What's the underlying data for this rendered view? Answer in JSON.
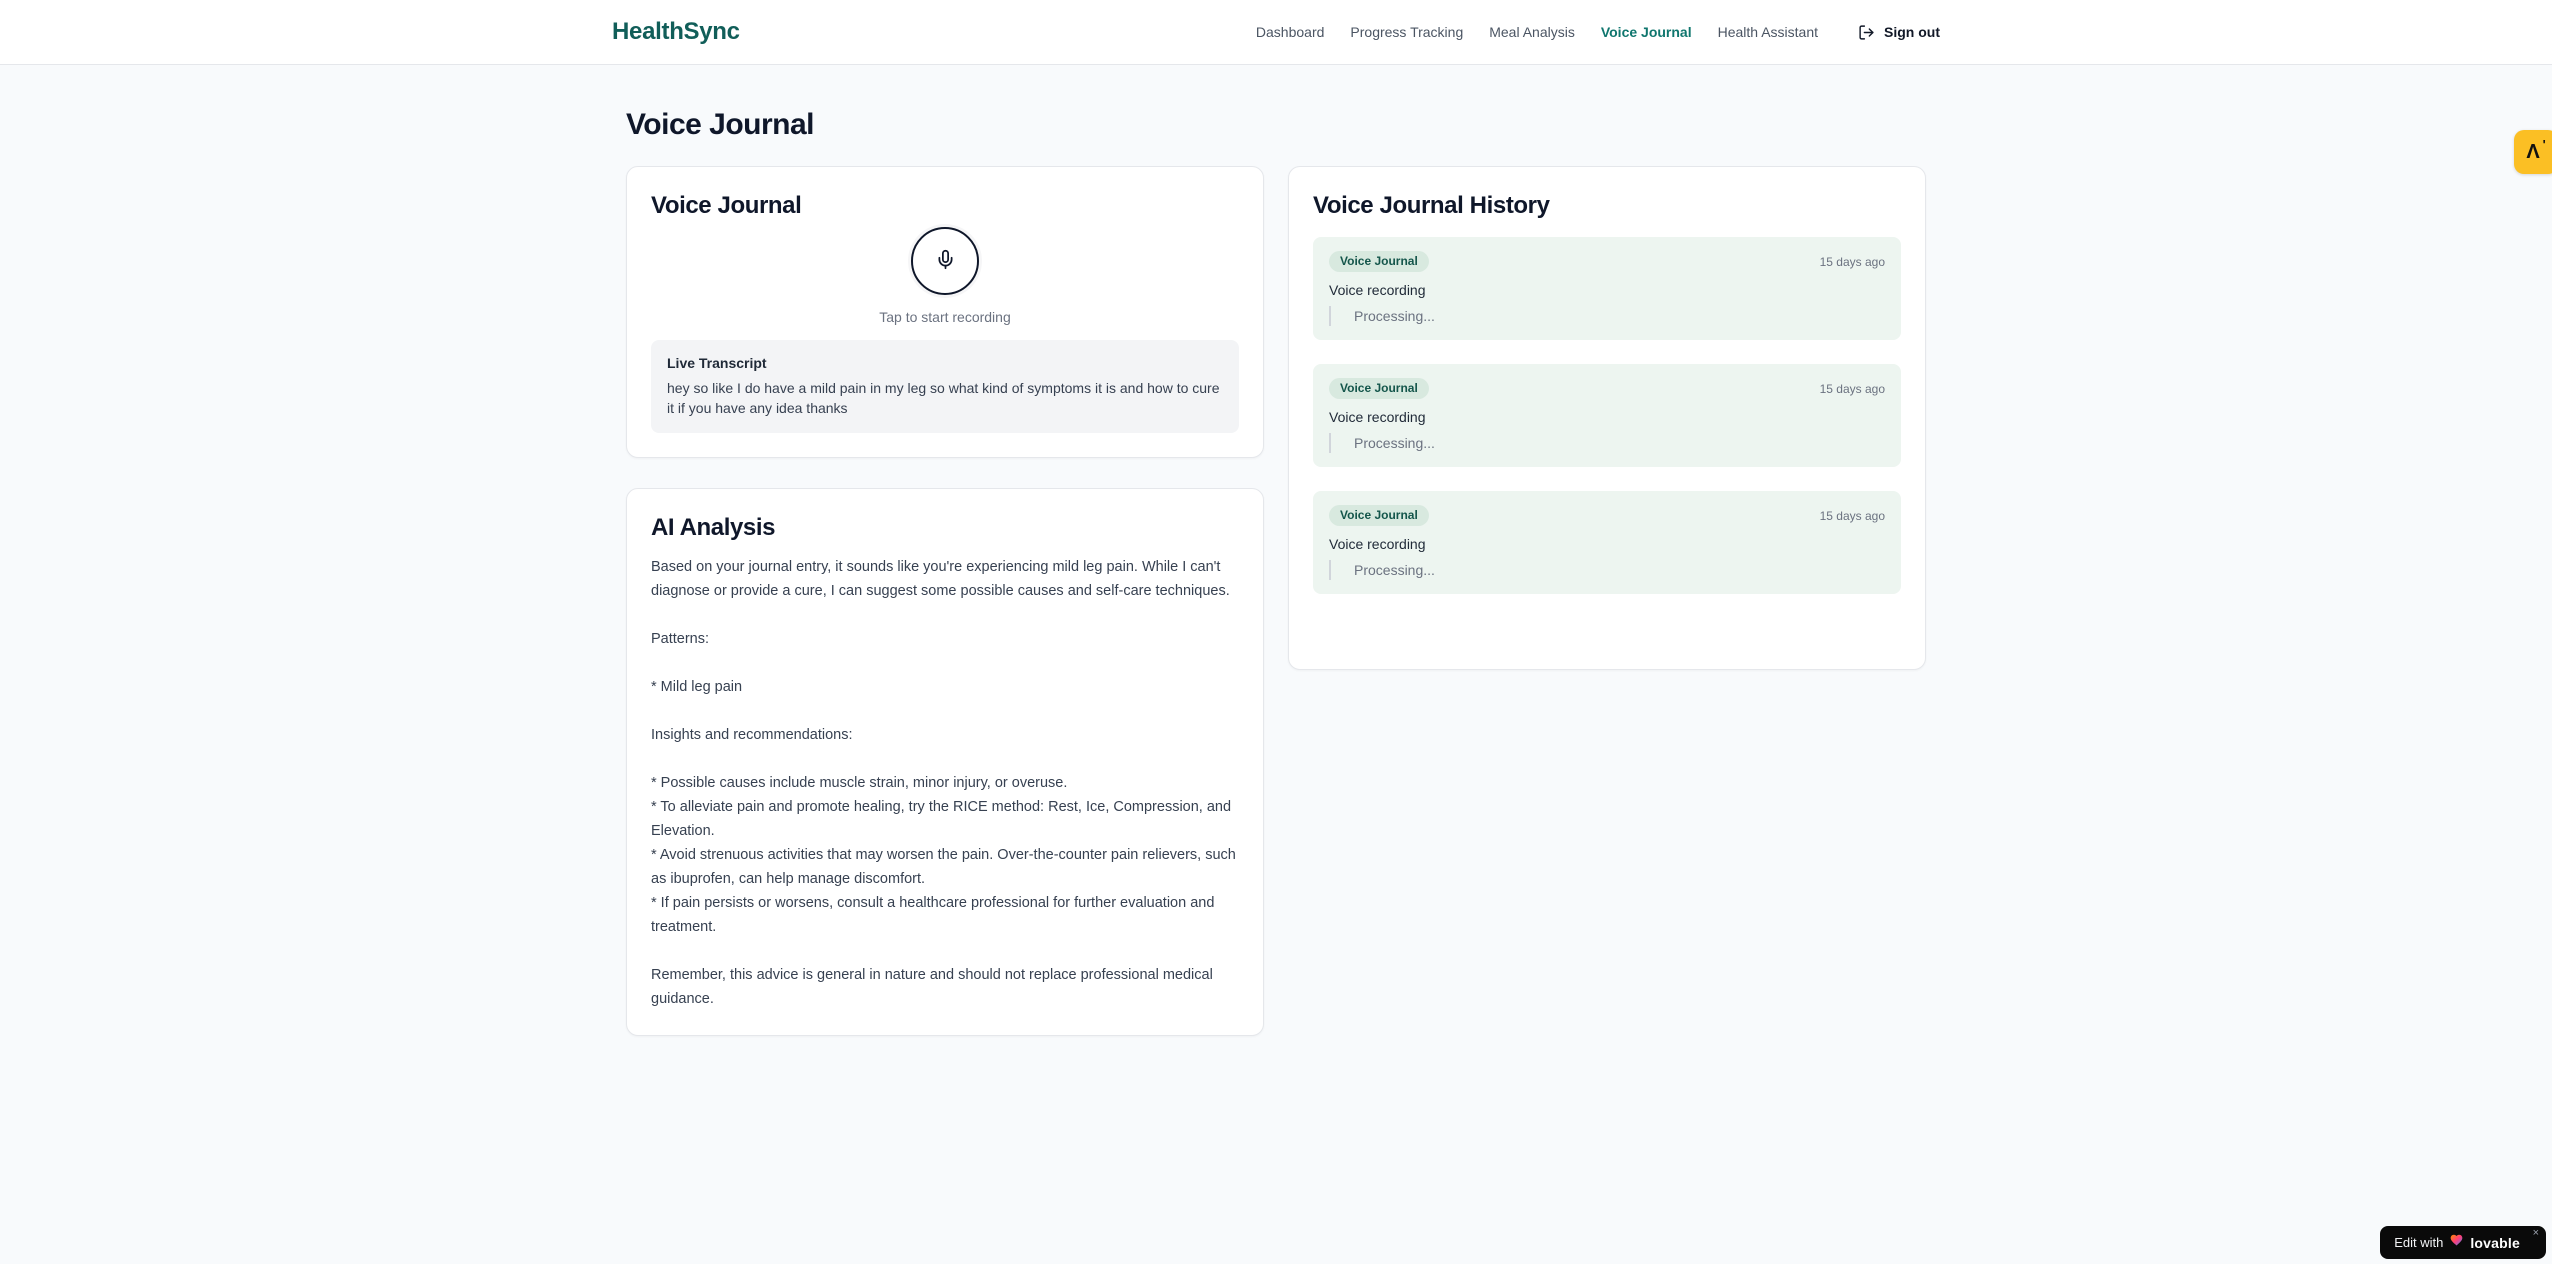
{
  "header": {
    "logo": "HealthSync",
    "nav": [
      {
        "label": "Dashboard",
        "active": false
      },
      {
        "label": "Progress Tracking",
        "active": false
      },
      {
        "label": "Meal Analysis",
        "active": false
      },
      {
        "label": "Voice Journal",
        "active": true
      },
      {
        "label": "Health Assistant",
        "active": false
      }
    ],
    "sign_out_label": "Sign out"
  },
  "page": {
    "title": "Voice Journal"
  },
  "recorder_card": {
    "title": "Voice Journal",
    "tap_hint": "Tap to start recording",
    "live_transcript_label": "Live Transcript",
    "transcript": "hey so like I do have a mild pain in my leg so what kind of symptoms it is and how to cure it if you have any idea thanks"
  },
  "analysis_card": {
    "title": "AI Analysis",
    "body": "Based on your journal entry, it sounds like you're experiencing mild leg pain. While I can't diagnose or provide a cure, I can suggest some possible causes and self-care techniques.\n\nPatterns:\n\n* Mild leg pain\n\nInsights and recommendations:\n\n* Possible causes include muscle strain, minor injury, or overuse.\n* To alleviate pain and promote healing, try the RICE method: Rest, Ice, Compression, and Elevation.\n* Avoid strenuous activities that may worsen the pain. Over-the-counter pain relievers, such as ibuprofen, can help manage discomfort.\n* If pain persists or worsens, consult a healthcare professional for further evaluation and treatment.\n\nRemember, this advice is general in nature and should not replace professional medical guidance."
  },
  "history_card": {
    "title": "Voice Journal History",
    "entries": [
      {
        "badge": "Voice Journal",
        "time": "15 days ago",
        "description": "Voice recording",
        "status": "Processing..."
      },
      {
        "badge": "Voice Journal",
        "time": "15 days ago",
        "description": "Voice recording",
        "status": "Processing..."
      },
      {
        "badge": "Voice Journal",
        "time": "15 days ago",
        "description": "Voice recording",
        "status": "Processing..."
      }
    ]
  },
  "floating": {
    "side_tab_glyph": "Λ",
    "edit_badge_prefix": "Edit with",
    "edit_badge_brand": "lovable",
    "edit_badge_close": "×"
  },
  "colors": {
    "brand_teal": "#115e59",
    "active_nav_teal": "#0f766e",
    "page_background": "#f8fafc",
    "card_border": "#e5e7eb",
    "history_entry_green": "#edf5f0",
    "badge_green_bg": "#d8e9df",
    "badge_green_text": "#14564b",
    "side_tab_amber": "#fbbf24",
    "edit_badge_black": "#0a0a0a"
  }
}
